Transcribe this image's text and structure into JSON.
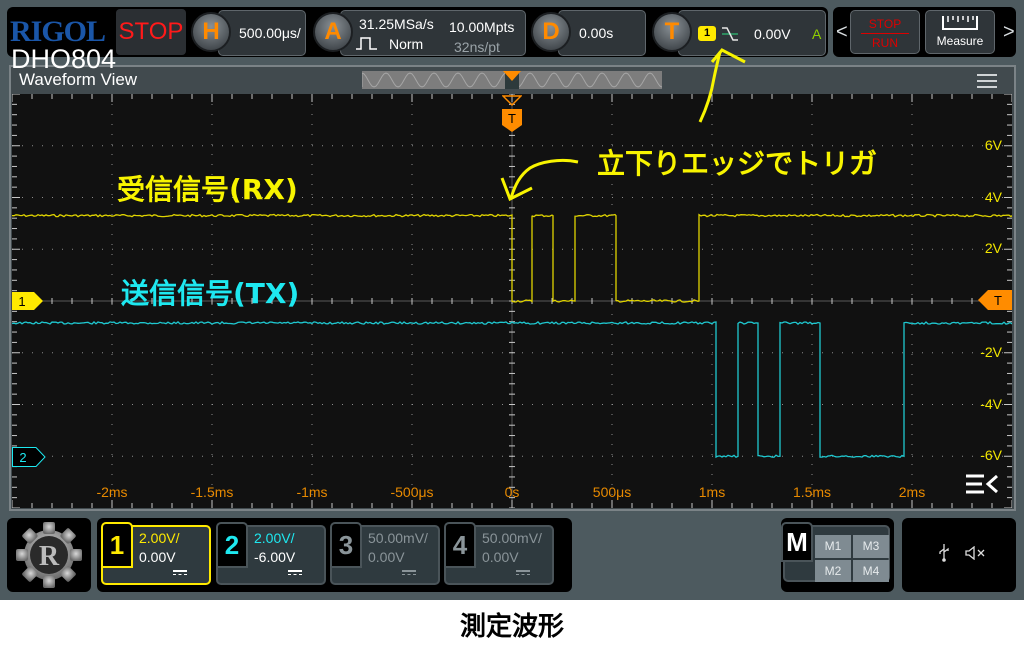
{
  "header": {
    "brand": "RIGOL",
    "model": "DHO804",
    "run_state": "STOP"
  },
  "horizontal": {
    "knob": "H",
    "timebase": "500.00μs/"
  },
  "acquire": {
    "knob": "A",
    "sample_rate": "31.25MSa/s",
    "mode": "Norm",
    "memory_depth": "10.00Mpts",
    "resolution": "32ns/pt"
  },
  "delay": {
    "knob": "D",
    "value": "0.00s"
  },
  "trigger": {
    "knob": "T",
    "source": "1",
    "edge": "falling-edge-icon",
    "level": "0.00V",
    "sweep": "A"
  },
  "controls": {
    "stop_label": "STOP",
    "run_label": "RUN",
    "measure_label": "Measure",
    "prev": "<",
    "next": ">"
  },
  "waveform_view": {
    "title": "Waveform View",
    "trigger_marker": "T",
    "ch1_marker": "1",
    "ch2_marker": "2",
    "trigger_level_marker": "T",
    "y_labels": [
      "6V",
      "4V",
      "2V",
      "-2V",
      "-4V",
      "-6V"
    ],
    "x_labels": [
      "-2ms",
      "-1.5ms",
      "-1ms",
      "-500μs",
      "0s",
      "500μs",
      "1ms",
      "1.5ms",
      "2ms"
    ]
  },
  "annotations": {
    "rx_label": "受信信号(RX)",
    "tx_label": "送信信号(TX)",
    "trigger_note": "立下りエッジでトリガ"
  },
  "channels": [
    {
      "num": "1",
      "scale": "2.00V/",
      "offset": "0.00V",
      "color": "#ffea00",
      "active": true
    },
    {
      "num": "2",
      "scale": "2.00V/",
      "offset": "-6.00V",
      "color": "#1ee8f0",
      "active": false
    },
    {
      "num": "3",
      "scale": "50.00mV/",
      "offset": "0.00V",
      "color": "#8a9499",
      "active": false
    },
    {
      "num": "4",
      "scale": "50.00mV/",
      "offset": "0.00V",
      "color": "#8a9499",
      "active": false
    }
  ],
  "math": {
    "label": "M",
    "items": [
      "M1",
      "M3",
      "M2",
      "M4"
    ]
  },
  "status": {
    "usb": "usb-icon",
    "sound": "mute-icon"
  },
  "caption": "測定波形",
  "traces": {
    "time_range_ms": [
      -2.5,
      2.5
    ],
    "volt_range": [
      -8,
      8
    ],
    "ch1": {
      "color": "#e0d400",
      "high_v": 3.3,
      "low_v": 0.0,
      "edges_ms": [
        0.0,
        0.1,
        0.205,
        0.315,
        0.52,
        0.935
      ]
    },
    "ch2": {
      "color": "#1fc8d0",
      "high_v": -0.85,
      "low_v": -6.0,
      "edges_ms": [
        1.02,
        1.13,
        1.23,
        1.34,
        1.54,
        1.96
      ]
    }
  }
}
